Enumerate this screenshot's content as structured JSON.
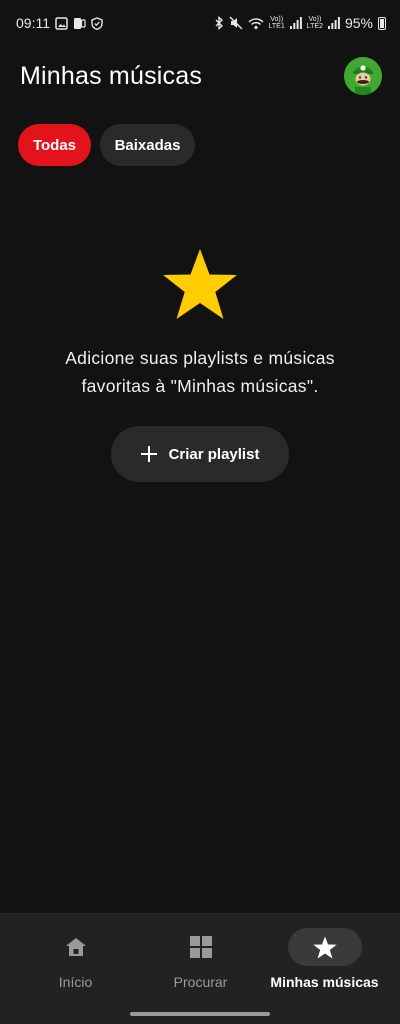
{
  "status_bar": {
    "time": "09:11",
    "volte1": "Vo))",
    "lte1": "LTE1",
    "volte2": "Vo))",
    "lte2": "LTE2",
    "battery": "95%"
  },
  "header": {
    "title": "Minhas músicas"
  },
  "chips": [
    {
      "label": "Todas",
      "selected": true
    },
    {
      "label": "Baixadas",
      "selected": false
    }
  ],
  "empty_state": {
    "icon": "star-icon",
    "message": "Adicione suas playlists e músicas favoritas à \"Minhas músicas\".",
    "button_label": "Criar playlist"
  },
  "bottom_nav": {
    "items": [
      {
        "label": "Início",
        "icon": "home-icon",
        "active": false
      },
      {
        "label": "Procurar",
        "icon": "grid-icon",
        "active": false
      },
      {
        "label": "Minhas músicas",
        "icon": "star-icon",
        "active": true
      }
    ]
  },
  "colors": {
    "background": "#121212",
    "accent": "#e3131c",
    "star": "#ffcc00",
    "surface": "#2a2a2a",
    "nav_background": "#222222"
  }
}
